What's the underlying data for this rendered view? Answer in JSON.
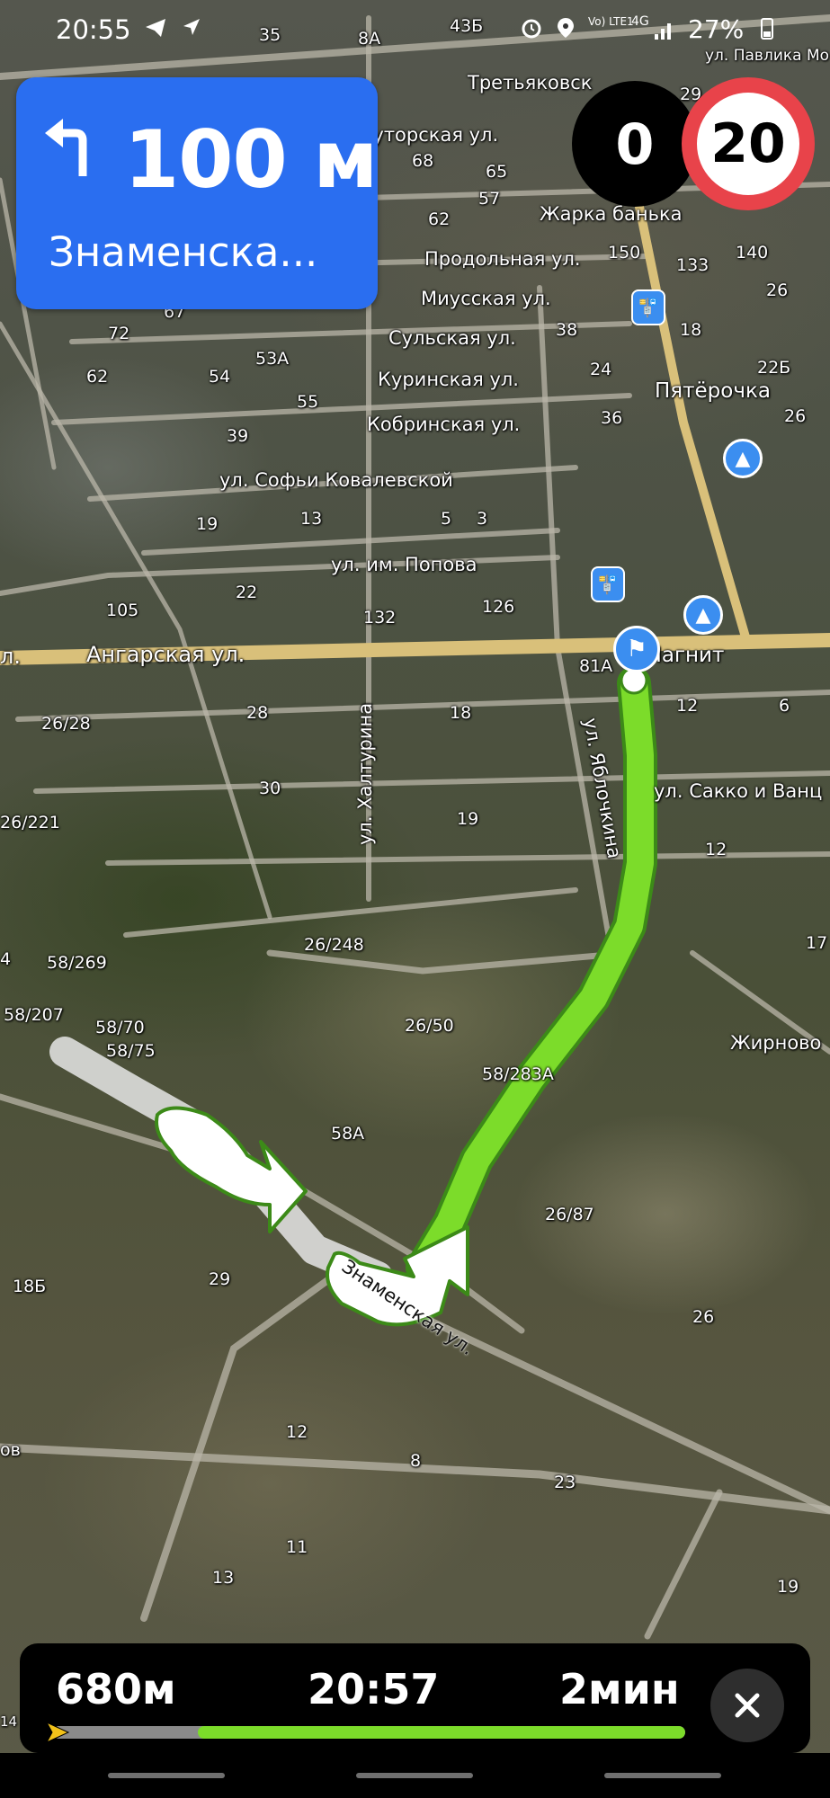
{
  "status_bar": {
    "time": "20:55",
    "network": "Vo) LTE1",
    "signal": "4G",
    "battery": "27%"
  },
  "maneuver": {
    "distance": "100 м",
    "street": "Знаменска...",
    "turn_icon": "turn-left-icon"
  },
  "speed": {
    "current": "0",
    "limit": "20"
  },
  "map": {
    "streets": {
      "ul_pavlika": "ул. Павлика Мо",
      "tretyakovskaya": "Третьяковск",
      "khutorskaya": "Хуторская ул.",
      "zharka": "Жарка банька",
      "prodolnaya": "Продольная ул.",
      "miusskaya": "Миусская ул.",
      "sulskaya": "Сульская ул.",
      "kurinskaya": "Куринская ул.",
      "kobrinskaya": "Кобринская ул.",
      "kovalevskoy": "ул. Софьи Ковалевской",
      "popova": "ул. им. Попова",
      "angarskaya": "Ангарская ул.",
      "angarskaya_left": "л.",
      "khalturina": "ул. Халтурина",
      "yablochkina": "ул. Яблочкина",
      "sakko": "ул. Сакко и Ванц",
      "zhirnovo": "Жирново",
      "znamenskaya": "Знаменская ул.",
      "pyaterochka": "Пятёрочка",
      "magnit": "Магнит",
      "ov": "ов"
    },
    "numbers": {
      "n35": "35",
      "n8A": "8А",
      "n43B": "43Б",
      "n29": "29",
      "n68": "68",
      "n65": "65",
      "n57": "57",
      "n62a": "62",
      "n150": "150",
      "n133": "133",
      "n140": "140",
      "n26a": "26",
      "n67": "67",
      "n72": "72",
      "n53A": "53А",
      "n38": "38",
      "n18a": "18",
      "n24": "24",
      "n22B": "22Б",
      "n62b": "62",
      "n54": "54",
      "n55": "55",
      "n36": "36",
      "n26b": "26",
      "n39": "39",
      "n19a": "19",
      "n13a": "13",
      "n5": "5",
      "n3": "3",
      "n22": "22",
      "n105": "105",
      "n126": "126",
      "n132": "132",
      "n81A": "81А",
      "n26_28": "26/28",
      "n28": "28",
      "n18b": "18",
      "n12a": "12",
      "n6": "6",
      "n30": "30",
      "n26_221": "26/221",
      "n19b": "19",
      "n12b": "12",
      "n4": "4",
      "n58_269": "58/269",
      "n26_248": "26/248",
      "n17": "17",
      "n58_207": "58/207",
      "n58_70": "58/70",
      "n26_50": "26/50",
      "n58_75": "58/75",
      "n58_283A": "58/283А",
      "n58A": "58А",
      "n26_87": "26/87",
      "n29b": "29",
      "n18B": "18Б",
      "n26c": "26",
      "n12c": "12",
      "n8": "8",
      "n23": "23",
      "n11": "11",
      "n13b": "13",
      "n19c": "19",
      "n14": "14"
    }
  },
  "trip": {
    "remaining_distance": "680м",
    "arrival_time": "20:57",
    "remaining_time": "2мин",
    "progress": 0.77
  },
  "colors": {
    "route": "#7cdc2a",
    "maneuver_bg": "#2a6ef0",
    "speed_limit_ring": "#e8434a",
    "poi_blue": "#3b8ef0"
  }
}
